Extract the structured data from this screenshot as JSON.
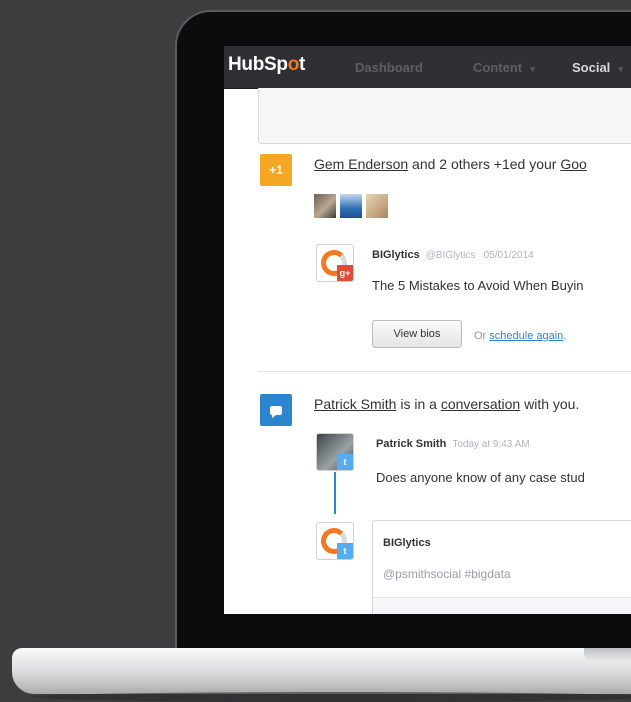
{
  "nav": {
    "logo_prefix": "HubSp",
    "logo_accent": "o",
    "logo_suffix": "t",
    "items": [
      {
        "label": "Dashboard"
      },
      {
        "label": "Content"
      },
      {
        "label": "Social"
      }
    ]
  },
  "activity1": {
    "badge": "+1",
    "actor": "Gem Enderson",
    "text": " and 2 others +1ed your ",
    "target": "Goo",
    "post": {
      "author": "BIGlytics",
      "handle": "@BIGlytics",
      "date": "05/01/2014",
      "text": "The 5 Mistakes to Avoid When Buyin"
    },
    "button_label": "View bios",
    "or_text": "Or ",
    "link_text": "schedule again",
    "link_suffix": "."
  },
  "activity2": {
    "actor": "Patrick Smith",
    "text1": " is in a ",
    "target": "conversation",
    "text2": " with you.",
    "post": {
      "author": "Patrick Smith",
      "time": "Today at 9:43 AM",
      "text": "Does anyone know of any case stud"
    },
    "reply": {
      "name": "BIGlytics",
      "input": "@psmithsocial #bigdata"
    }
  },
  "colors": {
    "accent_orange": "#f57722",
    "badge_yellow": "#f5a623",
    "badge_blue": "#2c86cf",
    "nav_bg": "#2e3033"
  }
}
